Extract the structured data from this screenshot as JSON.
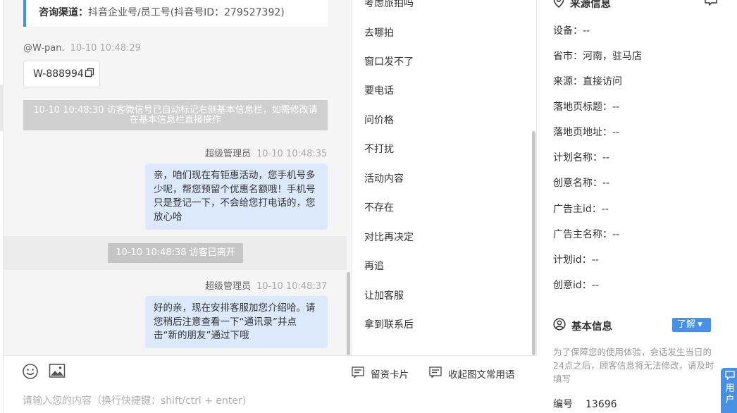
{
  "chat": {
    "channel_label": "咨询渠道：",
    "channel_value": "抖音企业号/员工号(抖音号ID：279527392)",
    "visitor_sender": "@W-pan.",
    "visitor_time": "10-10 10:48:29",
    "wechat_id": "W-888994",
    "system_notice": "10-10 10:48:30 访客微信号已自动标记右侧基本信息栏，如需修改请在基本信息栏直接操作",
    "agent_name_1": "超级管理员",
    "agent_time_1": "10-10 10:48:35",
    "agent_msg_1": "亲，咱们现在有钜惠活动，您手机号多少呢，帮您预留个优惠名额哦！手机号只是登记一下，不会给您打电话的，您放心哈",
    "visitor_left_notice": "10-10 10:48:38 访客已离开",
    "agent_name_2": "超级管理员",
    "agent_time_2": "10-10 10:48:37",
    "agent_msg_2": "好的亲，现在安排客服加您介绍哈。请您稍后注意查看一下“通讯录”并点击“新的朋友”通过下哦"
  },
  "input": {
    "placeholder": "请输入您的内容（换行快捷键：shift/ctrl + enter)",
    "card_action": "留资卡片",
    "collapse_action": "收起图文常用语"
  },
  "quick_replies": [
    "考虑旅拍吗",
    "去哪拍",
    "窗口发不了",
    "要电话",
    "问价格",
    "不打扰",
    "活动内容",
    "不存在",
    "对比再决定",
    "再追",
    "让加客服",
    "拿到联系后"
  ],
  "info": {
    "source_title": "来源信息",
    "source_rows": [
      "设备：--",
      "省市：河南，驻马店",
      "来源：直接访问",
      "落地页标题：--",
      "落地页地址：--",
      "计划名称：--",
      "创意名称：--",
      "广告主id：--",
      "广告主名称：--",
      "计划id：--",
      "创意id：--"
    ],
    "basic_title": "基本信息",
    "learn_label": "了解",
    "note": "为了保障您的使用体验，会话发生当日的24点之后，顾客信息将无法修改，请及时填写",
    "number_label": "编号",
    "number_value": "13696",
    "float_tab": "用户"
  }
}
